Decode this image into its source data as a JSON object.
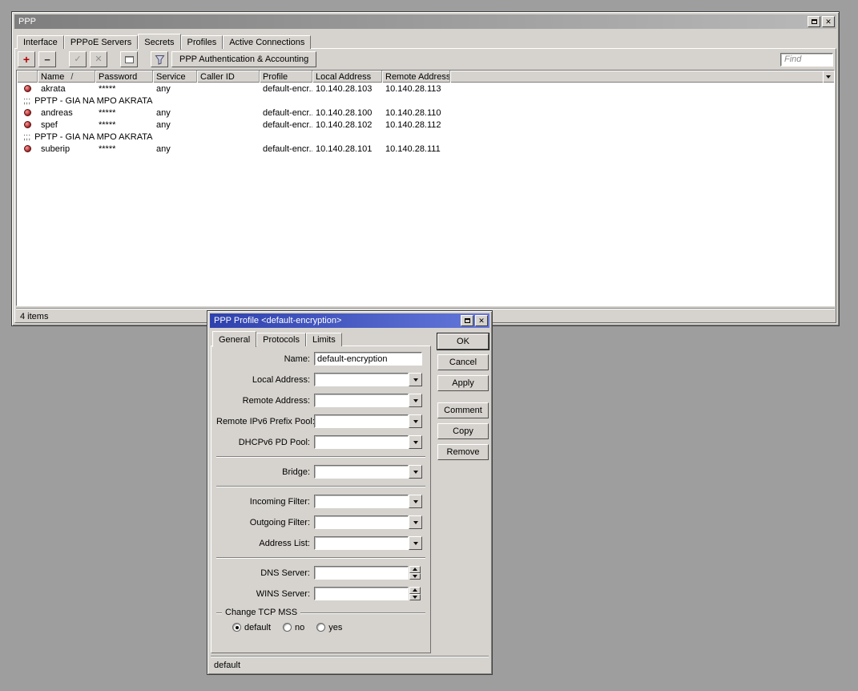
{
  "colors": {
    "desktop": "#9e9e9e",
    "window_face": "#d6d3ce",
    "titlebar_active": "#2e41ad",
    "titlebar_inactive": "#7e7e7e",
    "add_button_red": "#b40000"
  },
  "icons": {
    "close": "✕",
    "add": "+",
    "remove": "−",
    "enable": "✓",
    "disable": "✕"
  },
  "main_window": {
    "title": "PPP",
    "tabs": [
      {
        "label": "Interface",
        "active": false
      },
      {
        "label": "PPPoE Servers",
        "active": false
      },
      {
        "label": "Secrets",
        "active": true
      },
      {
        "label": "Profiles",
        "active": false
      },
      {
        "label": "Active Connections",
        "active": false
      }
    ],
    "toolbar": {
      "aaa_button_label": "PPP Authentication & Accounting",
      "find_placeholder": "Find"
    },
    "table": {
      "sort_glyph": "/",
      "comment_prefix": ";;;",
      "columns": [
        "Name",
        "Password",
        "Service",
        "Caller ID",
        "Profile",
        "Local Address",
        "Remote Address"
      ],
      "rows": [
        {
          "type": "item",
          "name": "akrata",
          "password": "*****",
          "service": "any",
          "caller_id": "",
          "profile": "default-encr...",
          "local_address": "10.140.28.103",
          "remote_address": "10.140.28.113"
        },
        {
          "type": "comment",
          "text": "PPTP - GIA NA MPO AKRATA"
        },
        {
          "type": "item",
          "name": "andreas",
          "password": "*****",
          "service": "any",
          "caller_id": "",
          "profile": "default-encr...",
          "local_address": "10.140.28.100",
          "remote_address": "10.140.28.110"
        },
        {
          "type": "item",
          "name": "spef",
          "password": "*****",
          "service": "any",
          "caller_id": "",
          "profile": "default-encr...",
          "local_address": "10.140.28.102",
          "remote_address": "10.140.28.112"
        },
        {
          "type": "comment",
          "text": "PPTP - GIA NA MPO AKRATA"
        },
        {
          "type": "item",
          "name": "suberip",
          "password": "*****",
          "service": "any",
          "caller_id": "",
          "profile": "default-encr...",
          "local_address": "10.140.28.101",
          "remote_address": "10.140.28.111"
        }
      ]
    },
    "status": "4 items"
  },
  "dialog": {
    "title": "PPP Profile <default-encryption>",
    "tabs": [
      {
        "label": "General",
        "active": true
      },
      {
        "label": "Protocols",
        "active": false
      },
      {
        "label": "Limits",
        "active": false
      }
    ],
    "buttons": [
      "OK",
      "Cancel",
      "Apply",
      "Comment",
      "Copy",
      "Remove"
    ],
    "fields": {
      "name": {
        "label": "Name:",
        "value": "default-encryption"
      },
      "local_address": {
        "label": "Local Address:",
        "value": ""
      },
      "remote_address": {
        "label": "Remote Address:",
        "value": ""
      },
      "remote_ipv6_prefix_pool": {
        "label": "Remote IPv6 Prefix Pool:",
        "value": ""
      },
      "dhcpv6_pd_pool": {
        "label": "DHCPv6 PD Pool:",
        "value": ""
      },
      "bridge": {
        "label": "Bridge:",
        "value": ""
      },
      "incoming_filter": {
        "label": "Incoming Filter:",
        "value": ""
      },
      "outgoing_filter": {
        "label": "Outgoing Filter:",
        "value": ""
      },
      "address_list": {
        "label": "Address List:",
        "value": ""
      },
      "dns_server": {
        "label": "DNS Server:",
        "value": ""
      },
      "wins_server": {
        "label": "WINS Server:",
        "value": ""
      }
    },
    "tcp_mss_group": {
      "label": "Change TCP MSS",
      "options": [
        "default",
        "no",
        "yes"
      ],
      "selected": "default"
    },
    "status": "default"
  }
}
